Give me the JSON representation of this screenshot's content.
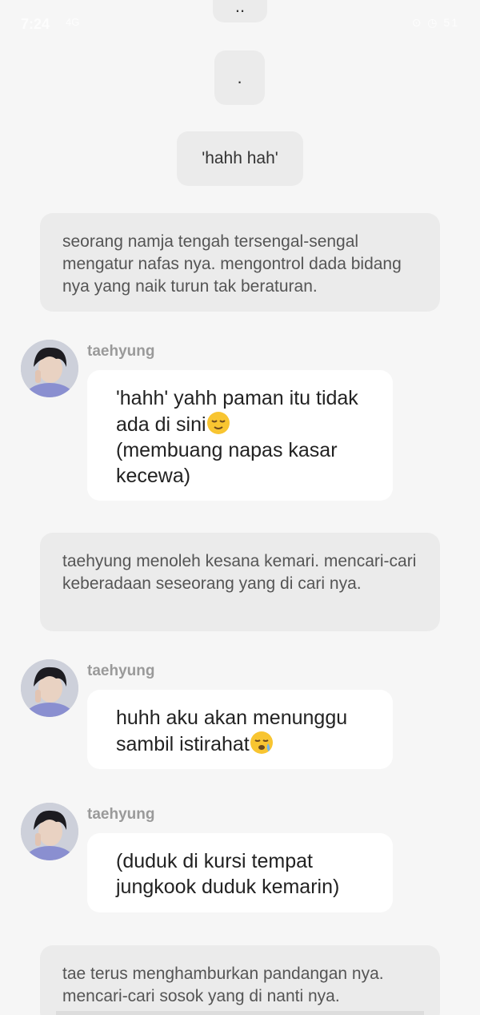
{
  "status_bar": {
    "time": "7:24",
    "signal": "4G",
    "icons": "⊙ ◷ 51"
  },
  "chat": [
    {
      "type": "narration-pill",
      "text": ".."
    },
    {
      "type": "narration-pill",
      "text": "."
    },
    {
      "type": "narration-pill",
      "text": "'hahh hah'"
    },
    {
      "type": "narration",
      "text": "seorang namja tengah tersengal-sengal mengatur nafas nya. mengontrol dada bidang nya yang naik turun tak beraturan."
    },
    {
      "type": "message",
      "sender": "taehyung",
      "lines": [
        "'hahh' yahh paman itu tidak",
        "ada di sini",
        "(membuang napas kasar",
        "kecewa)"
      ],
      "emoji": "relieved-face"
    },
    {
      "type": "narration",
      "text": "taehyung menoleh kesana kemari. mencari-cari keberadaan seseorang yang di cari nya."
    },
    {
      "type": "message",
      "sender": "taehyung",
      "lines": [
        "huhh aku akan menunggu",
        "sambil istirahat"
      ],
      "emoji": "sleepy-face"
    },
    {
      "type": "message",
      "sender": "taehyung",
      "lines": [
        "(duduk di kursi tempat",
        "jungkook duduk kemarin)"
      ]
    },
    {
      "type": "narration",
      "text": "tae terus menghamburkan pandangan nya. mencari-cari sosok yang di nanti nya."
    }
  ],
  "colors": {
    "background": "#f6f6f6",
    "narration_bg": "#ebebeb",
    "bubble_bg": "#ffffff",
    "sender_name": "#9a9a9a"
  }
}
